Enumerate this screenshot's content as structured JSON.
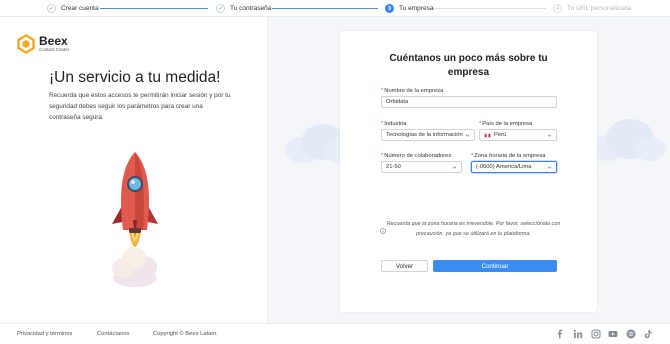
{
  "stepper": {
    "steps": [
      {
        "label": "Crear cuenta",
        "mark": "✓",
        "state": "done"
      },
      {
        "label": "Tu contraseña",
        "mark": "✓",
        "state": "done"
      },
      {
        "label": "Tu empresa",
        "mark": "3",
        "state": "active"
      },
      {
        "label": "Tu URL personalizada",
        "mark": "4",
        "state": "pending"
      }
    ]
  },
  "brand": {
    "name": "Beex",
    "subtitle": "Contact Center",
    "accent": "#f5a524"
  },
  "hero": {
    "title": "¡Un servicio a tu medida!",
    "description": "Recuerda que estos accesos te permitirán iniciar sesión y por tu seguridad debes seguir los parámetros para crear una contraseña segura."
  },
  "form": {
    "title": "Cuéntanos un poco más sobre tu empresa",
    "company_name": {
      "label": "Nombre de la empresa",
      "value": "Orbidata"
    },
    "industry": {
      "label": "Industria",
      "value": "Tecnologías de la información"
    },
    "country": {
      "label": "País de la empresa",
      "value": "Perú"
    },
    "employees": {
      "label": "Número de colaboradores",
      "value": "21-50"
    },
    "timezone": {
      "label": "Zona horaria de la empresa",
      "value": "(-0500) America/Lima"
    },
    "note": "Recuerda que la zona horaria es irreversible. Por favor, selecciónala con precaución, ya que se utilizará en tu plataforma.",
    "back_label": "Volver",
    "continue_label": "Continuar",
    "primary_color": "#3b8cf0"
  },
  "footer": {
    "privacy": "Privacidad y términos",
    "contact": "Contáctanos",
    "copyright": "Copyright © Beex Latam.",
    "social_icons": [
      "facebook-icon",
      "linkedin-icon",
      "instagram-icon",
      "youtube-icon",
      "spotify-icon",
      "tiktok-icon"
    ]
  }
}
